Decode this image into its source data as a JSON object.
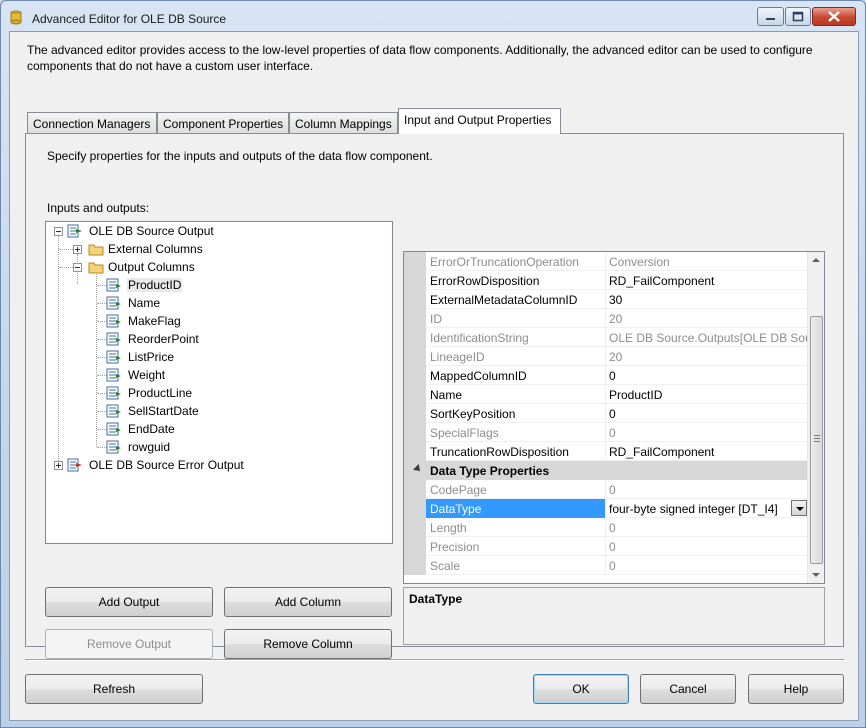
{
  "window": {
    "title": "Advanced Editor for OLE DB Source"
  },
  "intro_text": "The advanced editor provides access to the low-level properties of data flow components. Additionally, the advanced editor can be used to configure components that do not have a custom user interface.",
  "tabs": [
    {
      "label": "Connection Managers",
      "active": false
    },
    {
      "label": "Component Properties",
      "active": false
    },
    {
      "label": "Column Mappings",
      "active": false
    },
    {
      "label": "Input and Output Properties",
      "active": true
    }
  ],
  "panel": {
    "description": "Specify properties for the inputs and outputs of the data flow component.",
    "io_label": "Inputs and outputs:"
  },
  "tree": {
    "root_output": "OLE DB Source Output",
    "external_columns": "External Columns",
    "output_columns": "Output Columns",
    "columns": [
      "ProductID",
      "Name",
      "MakeFlag",
      "ReorderPoint",
      "ListPrice",
      "Weight",
      "ProductLine",
      "SellStartDate",
      "EndDate",
      "rowguid"
    ],
    "selected_column": "ProductID",
    "error_output": "OLE DB Source Error Output"
  },
  "buttons": {
    "add_output": "Add Output",
    "add_column": "Add Column",
    "remove_output": "Remove Output",
    "remove_column": "Remove Column",
    "refresh": "Refresh",
    "ok": "OK",
    "cancel": "Cancel",
    "help": "Help"
  },
  "properties": {
    "rows": [
      {
        "name": "ErrorOrTruncationOperation",
        "value": "Conversion",
        "readonly": true
      },
      {
        "name": "ErrorRowDisposition",
        "value": "RD_FailComponent",
        "readonly": false
      },
      {
        "name": "ExternalMetadataColumnID",
        "value": "30",
        "readonly": false
      },
      {
        "name": "ID",
        "value": "20",
        "readonly": true
      },
      {
        "name": "IdentificationString",
        "value": "OLE DB Source.Outputs[OLE DB Source",
        "readonly": true
      },
      {
        "name": "LineageID",
        "value": "20",
        "readonly": true
      },
      {
        "name": "MappedColumnID",
        "value": "0",
        "readonly": false
      },
      {
        "name": "Name",
        "value": "ProductID",
        "readonly": false
      },
      {
        "name": "SortKeyPosition",
        "value": "0",
        "readonly": false
      },
      {
        "name": "SpecialFlags",
        "value": "0",
        "readonly": true
      },
      {
        "name": "TruncationRowDisposition",
        "value": "RD_FailComponent",
        "readonly": false
      }
    ],
    "category": "Data Type Properties",
    "type_rows": [
      {
        "name": "CodePage",
        "value": "0",
        "readonly": true
      },
      {
        "name": "DataType",
        "value": "four-byte signed integer [DT_I4]",
        "readonly": false,
        "selected": true
      },
      {
        "name": "Length",
        "value": "0",
        "readonly": true
      },
      {
        "name": "Precision",
        "value": "0",
        "readonly": true
      },
      {
        "name": "Scale",
        "value": "0",
        "readonly": true
      }
    ],
    "description_title": "DataType"
  },
  "colors": {
    "selection": "#3399ff",
    "window_frame": "#c3d5ea",
    "readonly_text": "#8d8d8d"
  }
}
